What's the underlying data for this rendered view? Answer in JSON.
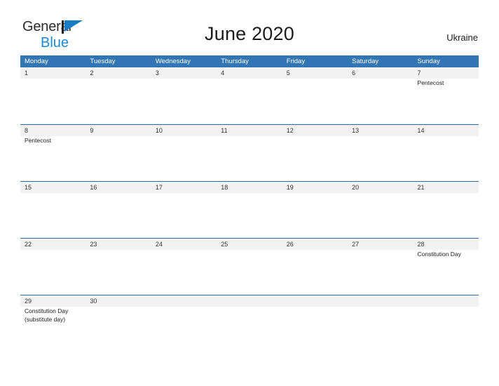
{
  "brand": {
    "name_part1": "General",
    "name_part2": "Blue",
    "flag_icon": "triangle-flag-icon",
    "colors": {
      "general_text": "#2b2b2b",
      "blue_text": "#1a8ad4",
      "flag": "#1a7dc4"
    }
  },
  "header": {
    "title": "June 2020",
    "country": "Ukraine"
  },
  "calendar": {
    "accent_color": "#3175b5",
    "daynum_band_color": "#f2f2f2",
    "row_divider_color": "#2e6da4",
    "weekdays": [
      "Monday",
      "Tuesday",
      "Wednesday",
      "Thursday",
      "Friday",
      "Saturday",
      "Sunday"
    ],
    "weeks": [
      {
        "days": [
          {
            "num": "1",
            "events": []
          },
          {
            "num": "2",
            "events": []
          },
          {
            "num": "3",
            "events": []
          },
          {
            "num": "4",
            "events": []
          },
          {
            "num": "5",
            "events": []
          },
          {
            "num": "6",
            "events": []
          },
          {
            "num": "7",
            "events": [
              "Pentecost"
            ]
          }
        ]
      },
      {
        "days": [
          {
            "num": "8",
            "events": [
              "Pentecost"
            ]
          },
          {
            "num": "9",
            "events": []
          },
          {
            "num": "10",
            "events": []
          },
          {
            "num": "11",
            "events": []
          },
          {
            "num": "12",
            "events": []
          },
          {
            "num": "13",
            "events": []
          },
          {
            "num": "14",
            "events": []
          }
        ]
      },
      {
        "days": [
          {
            "num": "15",
            "events": []
          },
          {
            "num": "16",
            "events": []
          },
          {
            "num": "17",
            "events": []
          },
          {
            "num": "18",
            "events": []
          },
          {
            "num": "19",
            "events": []
          },
          {
            "num": "20",
            "events": []
          },
          {
            "num": "21",
            "events": []
          }
        ]
      },
      {
        "days": [
          {
            "num": "22",
            "events": []
          },
          {
            "num": "23",
            "events": []
          },
          {
            "num": "24",
            "events": []
          },
          {
            "num": "25",
            "events": []
          },
          {
            "num": "26",
            "events": []
          },
          {
            "num": "27",
            "events": []
          },
          {
            "num": "28",
            "events": [
              "Constitution Day"
            ]
          }
        ]
      },
      {
        "days": [
          {
            "num": "29",
            "events": [
              "Constitution Day",
              "(substitute day)"
            ]
          },
          {
            "num": "30",
            "events": []
          },
          {
            "num": "",
            "events": []
          },
          {
            "num": "",
            "events": []
          },
          {
            "num": "",
            "events": []
          },
          {
            "num": "",
            "events": []
          },
          {
            "num": "",
            "events": []
          }
        ]
      }
    ]
  }
}
